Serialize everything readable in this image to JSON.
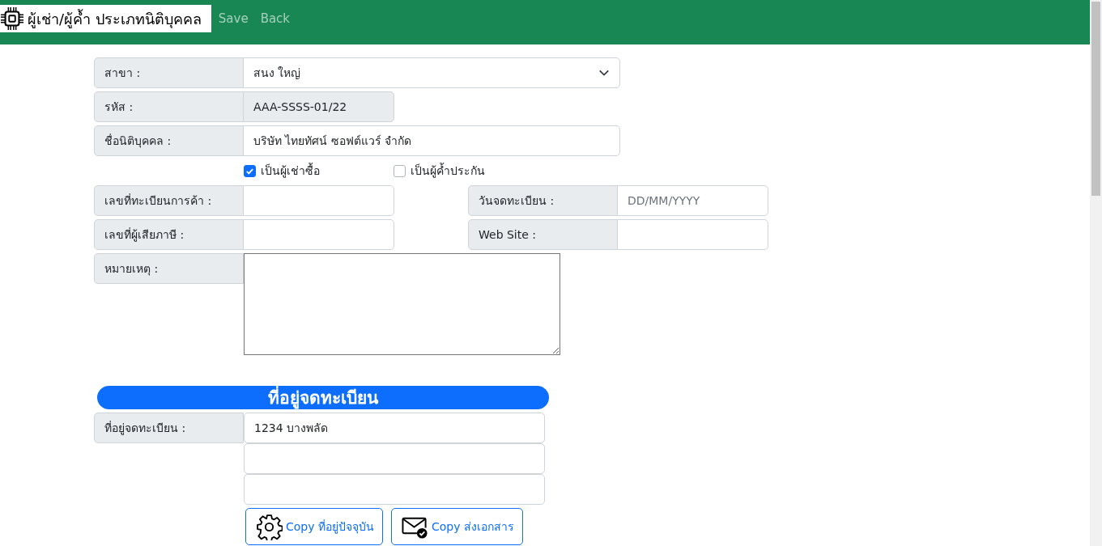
{
  "navbar": {
    "title": "ผู้เช่า/ผู้ค้ำ ประเภทนิติบุคคล",
    "links": [
      "Save",
      "Back"
    ]
  },
  "branch": {
    "label": "สาขา :",
    "value": "สนง ใหญ่"
  },
  "code": {
    "label": "รหัส :",
    "value": "AAA-SSSS-01/22",
    "disabled": true
  },
  "name": {
    "label": "ชื่อนิติบุคคล :",
    "value": "บริษัท ไทยทัศน์ ซอฟต์แวร์ จำกัด"
  },
  "checkboxes": [
    {
      "label": "เป็นผู้เช่าซื้อ",
      "checked": true
    },
    {
      "label": "เป็นผู้ค้ำประกัน",
      "checked": false
    }
  ],
  "trade_reg": {
    "label": "เลขที่ทะเบียนการค้า :"
  },
  "reg_date": {
    "label": "วันจดทะเบียน :",
    "placeholder": "DD/MM/YYYY"
  },
  "tax_id": {
    "label": "เลขที่ผู้เสียภาษี :"
  },
  "website": {
    "label": "Web Site :"
  },
  "note": {
    "label": "หมายเหตุ :"
  },
  "address": {
    "title": "ที่อยู่จดทะเบียน",
    "label": "ที่อยู่จดทะเบียน :",
    "lines": [
      "1234 บางพลัด"
    ]
  },
  "buttons": [
    {
      "label": "Copy ที่อยู่ปัจจุบัน",
      "kind": "gear"
    },
    {
      "label": "Copy ส่งเอกสาร",
      "kind": "mail"
    }
  ]
}
